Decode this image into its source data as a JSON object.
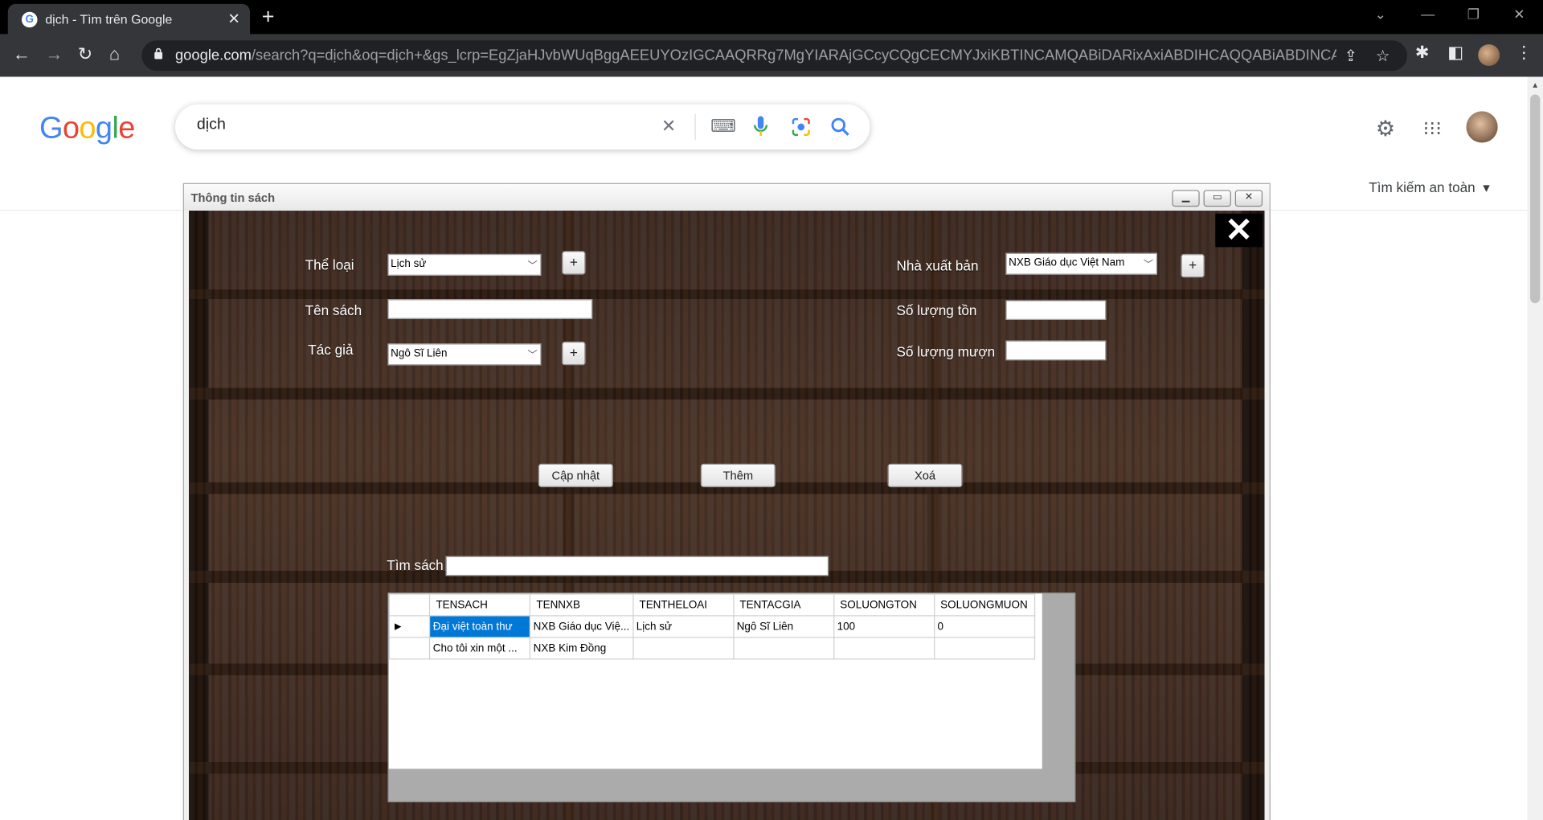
{
  "browser": {
    "tab_title": "dịch - Tìm trên Google",
    "url_host": "google.com",
    "url_path": "/search?q=dịch&oq=dịch+&gs_lcrp=EgZjaHJvbWUqBggAEEUYOzIGCAAQRRg7MgYIARAjGCcyCQgCECMYJxiKBTINCAMQABiDARixAxiABDIHCAQQABiABDINCAUQABiDARixA..."
  },
  "google": {
    "logo": "Google",
    "query": "dịch",
    "safesearch_label": "Tìm kiếm an toàn"
  },
  "dialog": {
    "title": "Thông tin sách",
    "labels": {
      "category": "Thể loại",
      "book_name": "Tên sách",
      "author": "Tác giả",
      "publisher": "Nhà xuất bản",
      "stock_qty": "Số lượng tồn",
      "borrow_qty": "Số lượng mượn",
      "search": "Tìm sách"
    },
    "values": {
      "category": "Lịch sử",
      "author": "Ngô Sĩ Liên",
      "publisher": "NXB Giáo dục Việt Nam"
    },
    "buttons": {
      "update": "Cập nhật",
      "add": "Thêm",
      "delete": "Xoá",
      "plus": "+"
    },
    "grid": {
      "columns": [
        "TENSACH",
        "TENNXB",
        "TENTHELOAI",
        "TENTACGIA",
        "SOLUONGTON",
        "SOLUONGMUON"
      ],
      "rows": [
        [
          "Đại việt toàn thư",
          "NXB Giáo dục Việ...",
          "Lịch sử",
          "Ngô Sĩ Liên",
          "100",
          "0"
        ],
        [
          "Cho tôi xin một ...",
          "NXB Kim Đồng",
          "",
          "",
          "",
          ""
        ]
      ]
    }
  }
}
